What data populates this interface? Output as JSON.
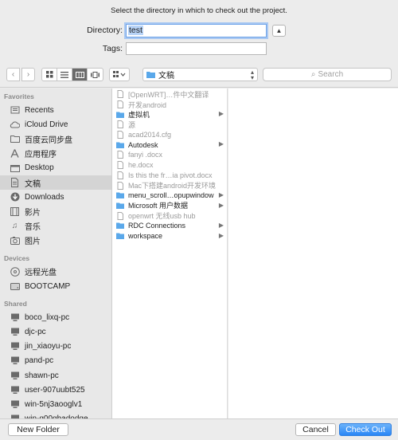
{
  "dialog": {
    "prompt": "Select the directory in which to check out the project.",
    "directory_label": "Directory:",
    "directory_value": "test",
    "tags_label": "Tags:",
    "tags_value": ""
  },
  "toolbar": {
    "location": "文稿",
    "search_placeholder": "Search"
  },
  "sidebar": {
    "favorites_header": "Favorites",
    "favorites": [
      {
        "label": "Recents",
        "icon": "recents-icon"
      },
      {
        "label": "iCloud Drive",
        "icon": "cloud-icon"
      },
      {
        "label": "百度云同步盘",
        "icon": "folder-icon"
      },
      {
        "label": "应用程序",
        "icon": "applications-icon"
      },
      {
        "label": "Desktop",
        "icon": "desktop-icon"
      },
      {
        "label": "文稿",
        "icon": "documents-icon"
      },
      {
        "label": "Downloads",
        "icon": "downloads-icon"
      },
      {
        "label": "影片",
        "icon": "movies-icon"
      },
      {
        "label": "音乐",
        "icon": "music-icon"
      },
      {
        "label": "图片",
        "icon": "pictures-icon"
      }
    ],
    "devices_header": "Devices",
    "devices": [
      {
        "label": "远程光盘",
        "icon": "disc-icon"
      },
      {
        "label": "BOOTCAMP",
        "icon": "drive-icon"
      }
    ],
    "shared_header": "Shared",
    "shared": [
      {
        "label": "boco_lixq-pc"
      },
      {
        "label": "djc-pc"
      },
      {
        "label": "jin_xiaoyu-pc"
      },
      {
        "label": "pand-pc"
      },
      {
        "label": "shawn-pc"
      },
      {
        "label": "user-907uubt525"
      },
      {
        "label": "win-5nj3aooglv1"
      },
      {
        "label": "win-q00qbadodqe"
      }
    ]
  },
  "files": [
    {
      "name": "[OpenWRT]…件中文翻译",
      "kind": "doc",
      "dim": true
    },
    {
      "name": "开发android",
      "kind": "doc",
      "dim": true
    },
    {
      "name": "虚拟机",
      "kind": "folder",
      "dim": false
    },
    {
      "name": "源",
      "kind": "doc",
      "dim": true
    },
    {
      "name": "acad2014.cfg",
      "kind": "doc",
      "dim": true
    },
    {
      "name": "Autodesk",
      "kind": "folder",
      "dim": false
    },
    {
      "name": "fanyi .docx",
      "kind": "doc",
      "dim": true
    },
    {
      "name": "he.docx",
      "kind": "doc",
      "dim": true
    },
    {
      "name": "Is this the fr…ia pivot.docx",
      "kind": "doc",
      "dim": true
    },
    {
      "name": "Mac下搭建android开发环境",
      "kind": "doc",
      "dim": true
    },
    {
      "name": "menu_scroll…opupwindow",
      "kind": "folder",
      "dim": false
    },
    {
      "name": "Microsoft 用户数据",
      "kind": "folder",
      "dim": false
    },
    {
      "name": "openwrt 无线usb hub",
      "kind": "doc",
      "dim": true
    },
    {
      "name": "RDC Connections",
      "kind": "folder",
      "dim": false
    },
    {
      "name": "workspace",
      "kind": "folder",
      "dim": false
    }
  ],
  "buttons": {
    "new_folder": "New Folder",
    "cancel": "Cancel",
    "check_out": "Check Out"
  },
  "colors": {
    "accent": "#2a86f6",
    "folder": "#5aa8ea",
    "selection": "#d4d4d4"
  }
}
